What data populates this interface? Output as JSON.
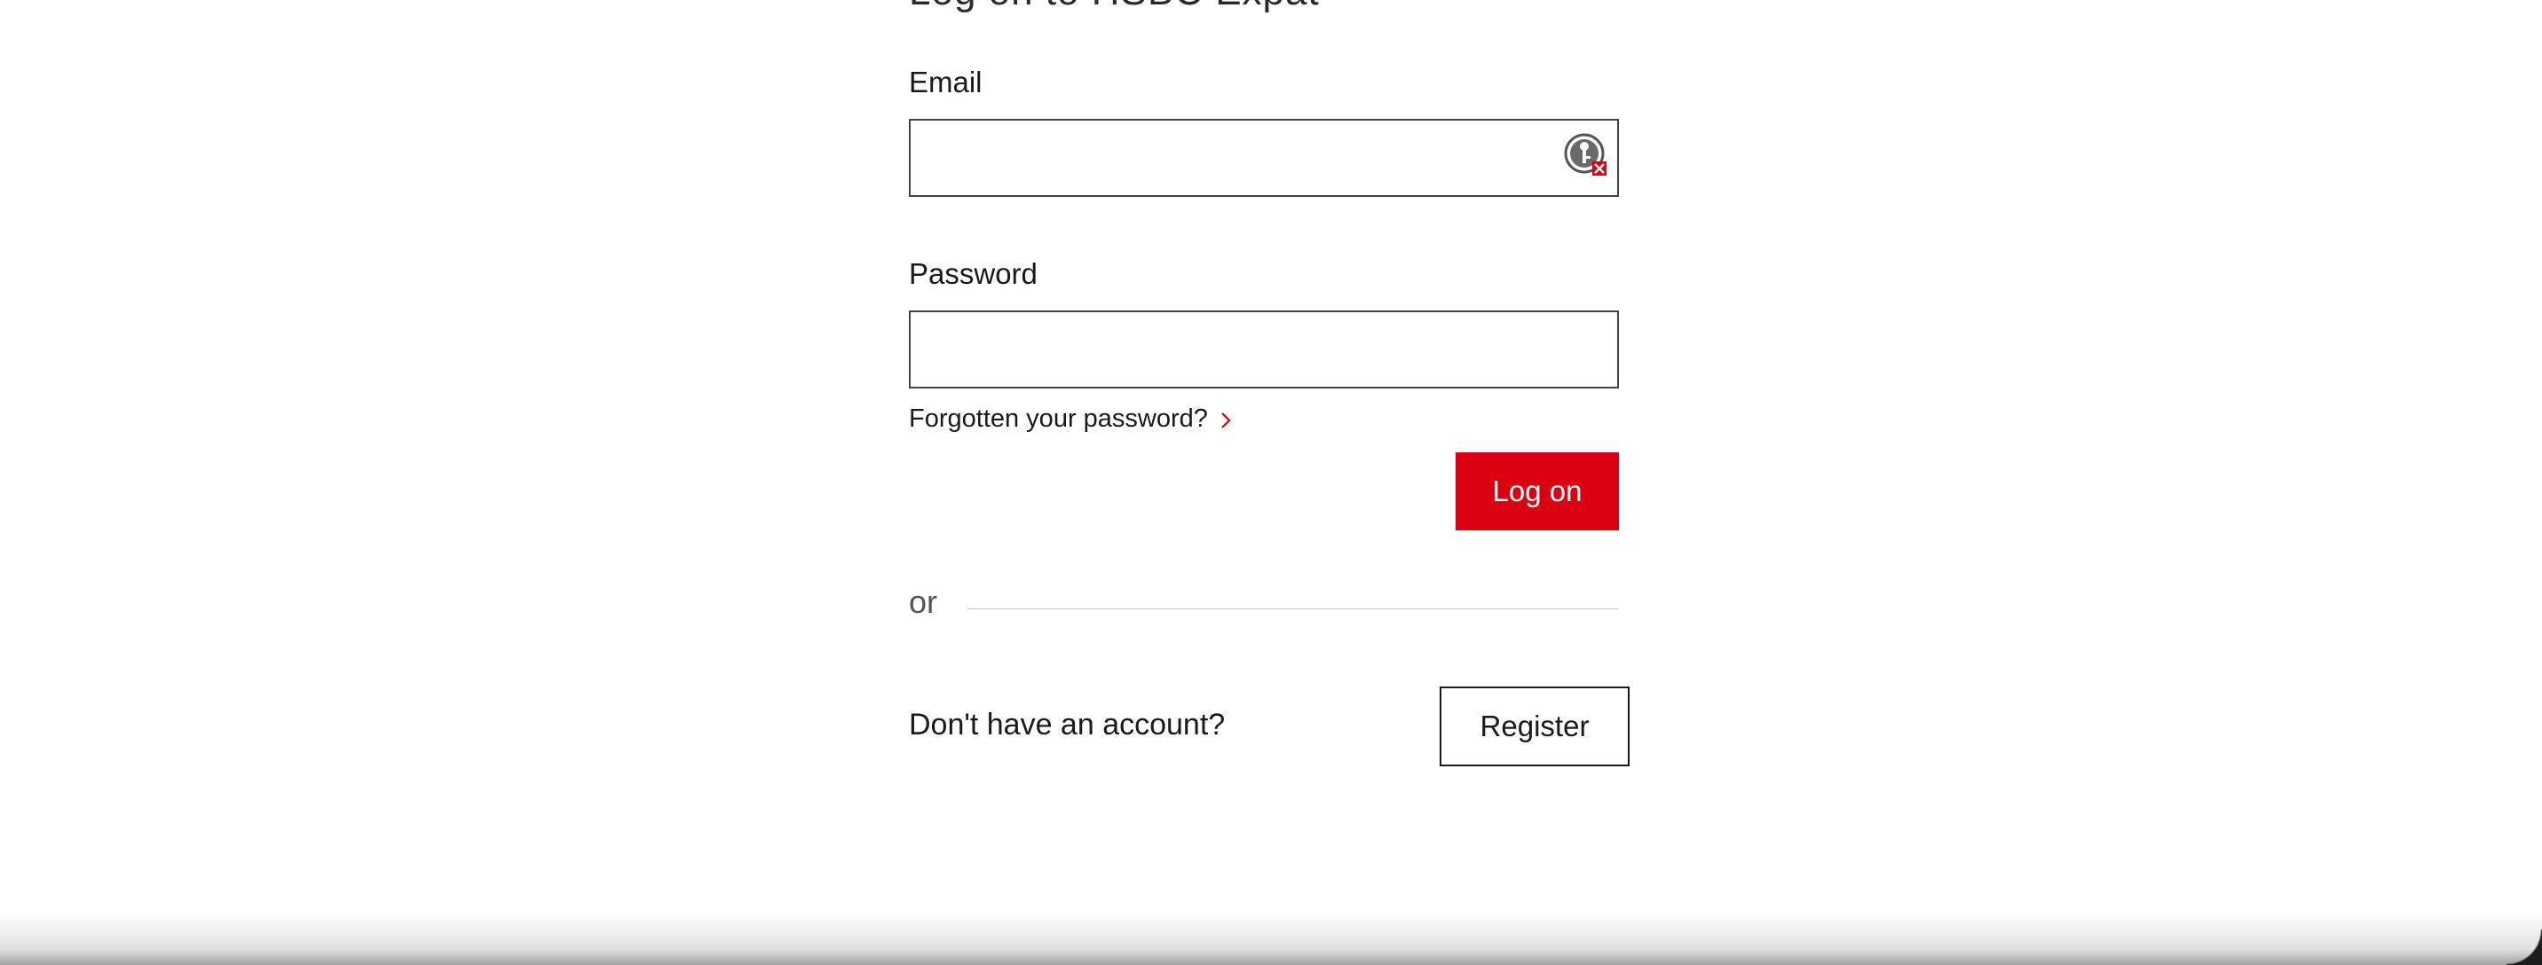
{
  "form": {
    "heading_partial": "Log on to HSBC Expat",
    "email": {
      "label": "Email",
      "value": "",
      "placeholder": ""
    },
    "password": {
      "label": "Password",
      "value": "",
      "placeholder": ""
    },
    "forgot_password_link": "Forgotten your password?",
    "log_on_button": "Log on",
    "divider_text": "or",
    "no_account_text": "Don't have an account?",
    "register_button": "Register"
  },
  "icons": {
    "password_manager": "password-manager-icon",
    "forgot_chevron": "chevron-right-icon"
  },
  "colors": {
    "brand_red": "#db0011",
    "text": "#1a1a1a",
    "border": "#444444",
    "divider": "#c8c8c8"
  }
}
